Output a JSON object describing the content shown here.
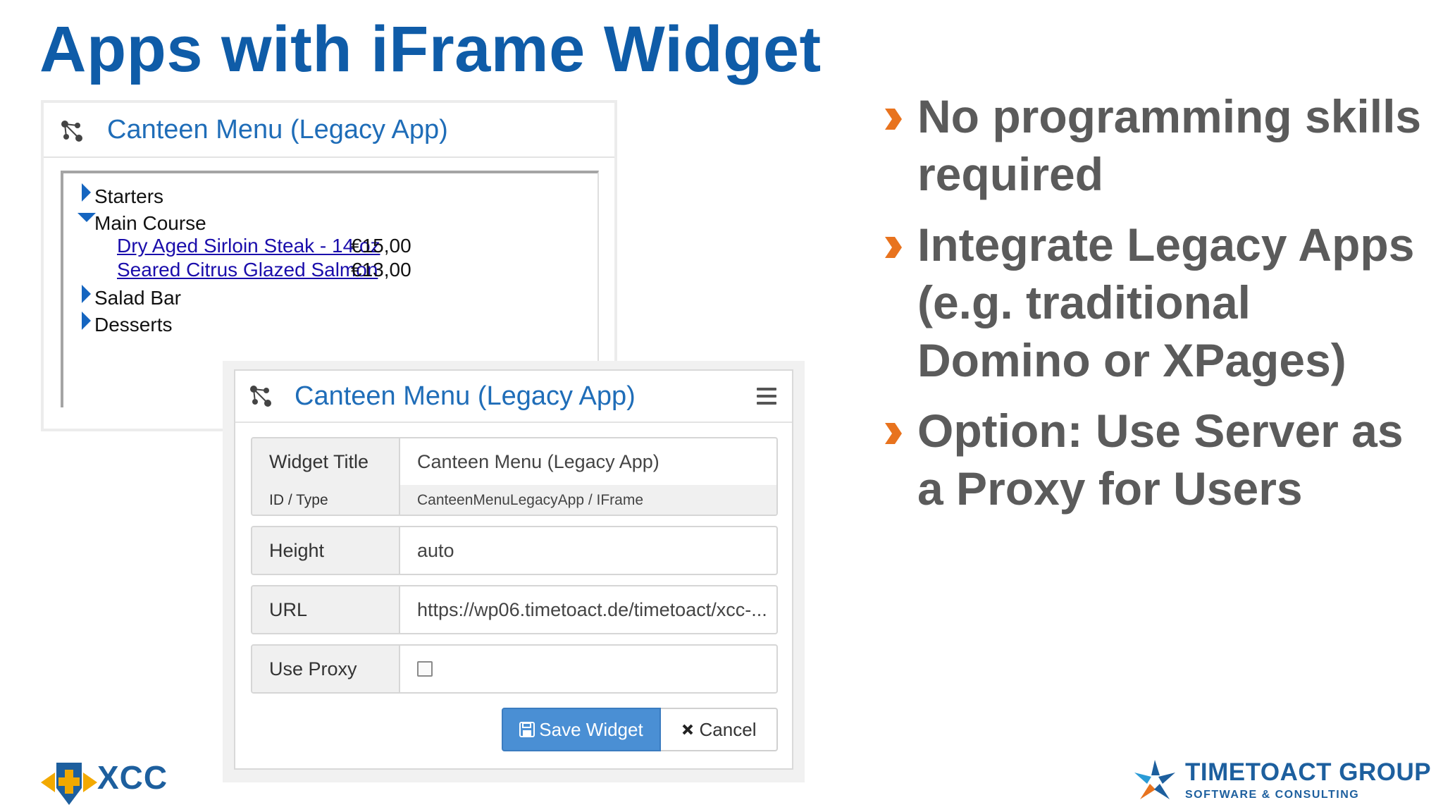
{
  "slide": {
    "title": "Apps with iFrame Widget"
  },
  "legacy_panel": {
    "title": "Canteen Menu (Legacy App)",
    "tree": {
      "starters": "Starters",
      "main_course": "Main Course",
      "items": [
        {
          "name": "Dry Aged Sirloin Steak - 14 oz",
          "price": "€15,00"
        },
        {
          "name": "Seared Citrus Glazed Salmon",
          "price": "€13,00"
        }
      ],
      "salad_bar": "Salad Bar",
      "desserts": "Desserts"
    }
  },
  "widget_panel": {
    "title": "Canteen Menu (Legacy App)",
    "fields": {
      "widget_title": {
        "label": "Widget Title",
        "value": "Canteen Menu (Legacy App)"
      },
      "id_type": {
        "label": "ID / Type",
        "value": "CanteenMenuLegacyApp / IFrame"
      },
      "height": {
        "label": "Height",
        "value": "auto"
      },
      "url": {
        "label": "URL",
        "value": "https://wp06.timetoact.de/timetoact/xcc-..."
      },
      "use_proxy": {
        "label": "Use Proxy",
        "checked": false
      }
    },
    "buttons": {
      "save": "Save Widget",
      "cancel": "Cancel"
    }
  },
  "bullets": [
    "No programming skills required",
    "Integrate Legacy Apps (e.g. traditional Domino or XPages)",
    "Option: Use Server as a Proxy for Users"
  ],
  "logos": {
    "xcc": "XCC",
    "timetoact_name": "TIMETOACT GROUP",
    "timetoact_sub": "SOFTWARE & CONSULTING"
  },
  "colors": {
    "title": "#0f5ca8",
    "bullet_text": "#5b5b5b",
    "bullet_marker": "#e8731e",
    "link": "#1a0dab",
    "save_button": "#4a8fd4"
  }
}
